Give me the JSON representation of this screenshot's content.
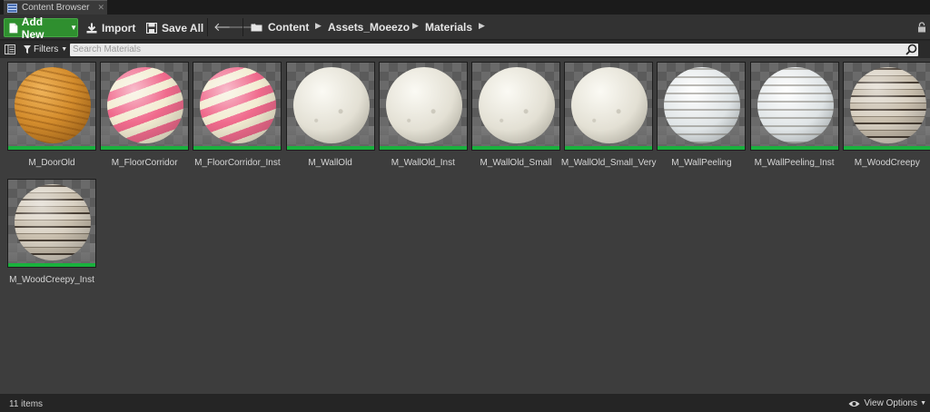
{
  "tab": {
    "title": "Content Browser"
  },
  "toolbar": {
    "add_new": "Add New",
    "import": "Import",
    "save_all": "Save All",
    "breadcrumbs": [
      "Content",
      "Assets_Moeezo",
      "Materials"
    ]
  },
  "filterbar": {
    "filters_label": "Filters",
    "search_placeholder": "Search Materials"
  },
  "assets": [
    {
      "name": "M_DoorOld",
      "material": "wood-orange"
    },
    {
      "name": "M_FloorCorridor",
      "material": "candy-stripe"
    },
    {
      "name": "M_FloorCorridor_Inst",
      "material": "candy-stripe"
    },
    {
      "name": "M_WallOld",
      "material": "plaster-white"
    },
    {
      "name": "M_WallOld_Inst",
      "material": "plaster-white"
    },
    {
      "name": "M_WallOld_Small",
      "material": "plaster-white"
    },
    {
      "name": "M_WallOld_Small_Very",
      "material": "plaster-white"
    },
    {
      "name": "M_WallPeeling",
      "material": "peeling-paint"
    },
    {
      "name": "M_WallPeeling_Inst",
      "material": "peeling-paint"
    },
    {
      "name": "M_WoodCreepy",
      "material": "creepy-wood"
    },
    {
      "name": "M_WoodCreepy_Inst",
      "material": "creepy-wood"
    }
  ],
  "status": {
    "item_count": "11 items",
    "view_options": "View Options"
  },
  "colors": {
    "accent_green": "#2f8f2f",
    "asset_type_bar": "#19b13d",
    "panel_bg": "#3d3d3d"
  }
}
